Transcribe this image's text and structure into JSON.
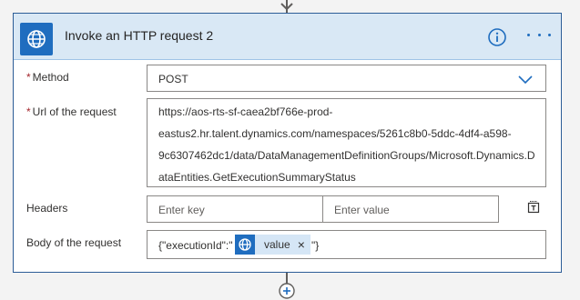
{
  "card": {
    "title": "Invoke an HTTP request 2",
    "app_icon": "globe-icon",
    "info_icon": "info-icon",
    "more_icon": "more-options-icon"
  },
  "fields": {
    "method": {
      "required_mark": "*",
      "label": "Method",
      "value": "POST"
    },
    "url": {
      "required_mark": "*",
      "label": "Url of the request",
      "lines": [
        "https://aos-rts-sf-caea2bf766e-prod-",
        "eastus2.hr.talent.dynamics.com/namespaces/5261c8b0-5ddc-4df4-a598-",
        "9c6307462dc1/data/DataManagementDefinitionGroups/Microsoft.Dynamics.D",
        "ataEntities.GetExecutionSummaryStatus"
      ]
    },
    "headers": {
      "label": "Headers",
      "key_placeholder": "Enter key",
      "value_placeholder": "Enter value"
    },
    "body": {
      "label": "Body of the request",
      "prefix": "{\"executionId\":\"",
      "token_label": "value",
      "token_remove": "×",
      "suffix": "\"}"
    }
  },
  "colors": {
    "accent": "#1f6dbf",
    "header_bg": "#d9e8f5",
    "required": "#a4262c"
  }
}
